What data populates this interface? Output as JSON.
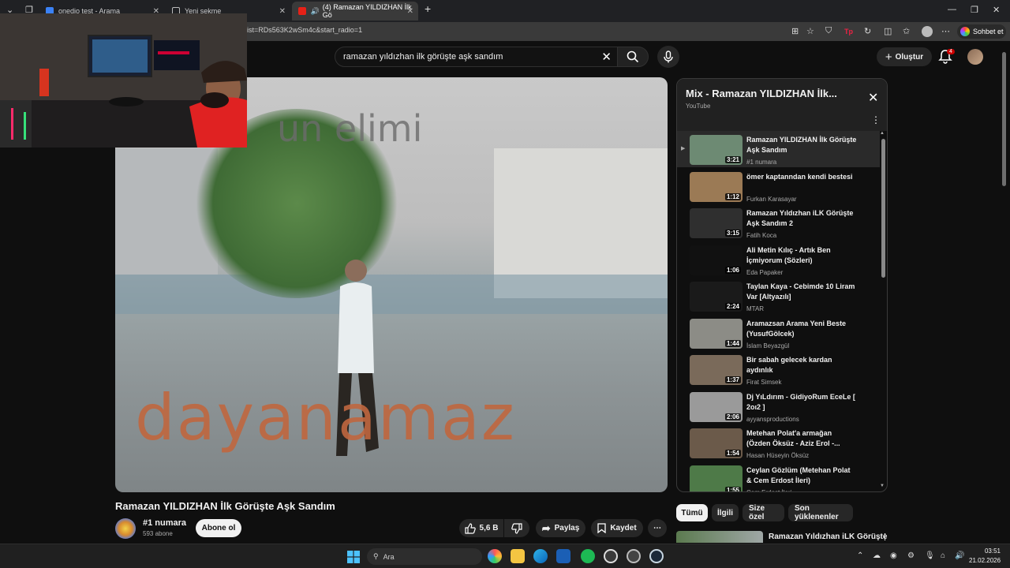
{
  "browser": {
    "tabs": [
      {
        "label": "onedio test - Arama",
        "active": false
      },
      {
        "label": "Yeni sekme",
        "active": false
      },
      {
        "label": "(4) Ramazan YILDIZHAN İlk Gö",
        "active": true
      }
    ],
    "url": "ist=RDs563K2wSm4c&start_radio=1",
    "chat_button": "Sohbet et"
  },
  "header": {
    "search_query": "ramazan yıldızhan ilk görüşte aşk sandım",
    "create_label": "Oluştur",
    "notification_count": "4"
  },
  "video": {
    "overlay_top": "un elimi",
    "overlay_bottom": "dayanamaz",
    "title": "Ramazan YILDIZHAN İlk Görüşte Aşk Sandım",
    "channel": "#1 numara",
    "subscribers": "593 abone",
    "subscribe_label": "Abone ol",
    "likes": "5,6 B",
    "share_label": "Paylaş",
    "save_label": "Kaydet"
  },
  "playlist": {
    "title": "Mix - Ramazan YILDIZHAN İlk...",
    "subtitle": "YouTube",
    "items": [
      {
        "title": "Ramazan YILDIZHAN İlk Görüşte Aşk Sandım",
        "channel": "#1 numara",
        "duration": "3:21",
        "current": true,
        "thumb": "#6d8a73"
      },
      {
        "title": "ömer kaptanndan kendi bestesi",
        "channel": "Furkan Karasayar",
        "duration": "1:12",
        "current": false,
        "thumb": "#9b7a55"
      },
      {
        "title": "Ramazan Yıldızhan iLK Görüşte Aşk Sandım 2",
        "channel": "Fatih Koca",
        "duration": "3:15",
        "current": false,
        "thumb": "#2f2f2f"
      },
      {
        "title": "Ali Metin Kılıç - Artık Ben İçmiyorum (Sözleri)",
        "channel": "Eda Papaker",
        "duration": "1:06",
        "current": false,
        "thumb": "#111111"
      },
      {
        "title": "Taylan Kaya - Cebimde 10 Liram Var [Altyazılı]",
        "channel": "MTAR",
        "duration": "2:24",
        "current": false,
        "thumb": "#1a1a1a"
      },
      {
        "title": "Aramazsan Arama Yeni Beste (YusufGölcek)",
        "channel": "İslam Beyazgül",
        "duration": "1:44",
        "current": false,
        "thumb": "#8c8c86"
      },
      {
        "title": "Bir sabah gelecek kardan aydınlık",
        "channel": "Firat Simsek",
        "duration": "1:37",
        "current": false,
        "thumb": "#7a6a5a"
      },
      {
        "title": "Dj YıLdırım - GidiyoRum EceLe [ 2oı2 ]",
        "channel": "ayyansproductions",
        "duration": "2:06",
        "current": false,
        "thumb": "#9a9a9a"
      },
      {
        "title": "Metehan Polat'a armağan (Özden Öksüz - Aziz Erol -...",
        "channel": "Hasan Hüseyin Öksüz",
        "duration": "1:54",
        "current": false,
        "thumb": "#6b5a4a"
      },
      {
        "title": "Ceylan Gözlüm (Metehan Polat & Cem Erdost İleri)",
        "channel": "Cem Erdost İleri",
        "duration": "1:55",
        "current": false,
        "thumb": "#4e7a48"
      }
    ]
  },
  "chips": [
    "Tümü",
    "İlgili",
    "Size özel",
    "Son yüklenenler"
  ],
  "related": {
    "title": "Ramazan Yıldızhan iLK Görüşte"
  },
  "taskbar": {
    "search_placeholder": "Ara",
    "time": "03:51",
    "date": "21.02.2026"
  }
}
